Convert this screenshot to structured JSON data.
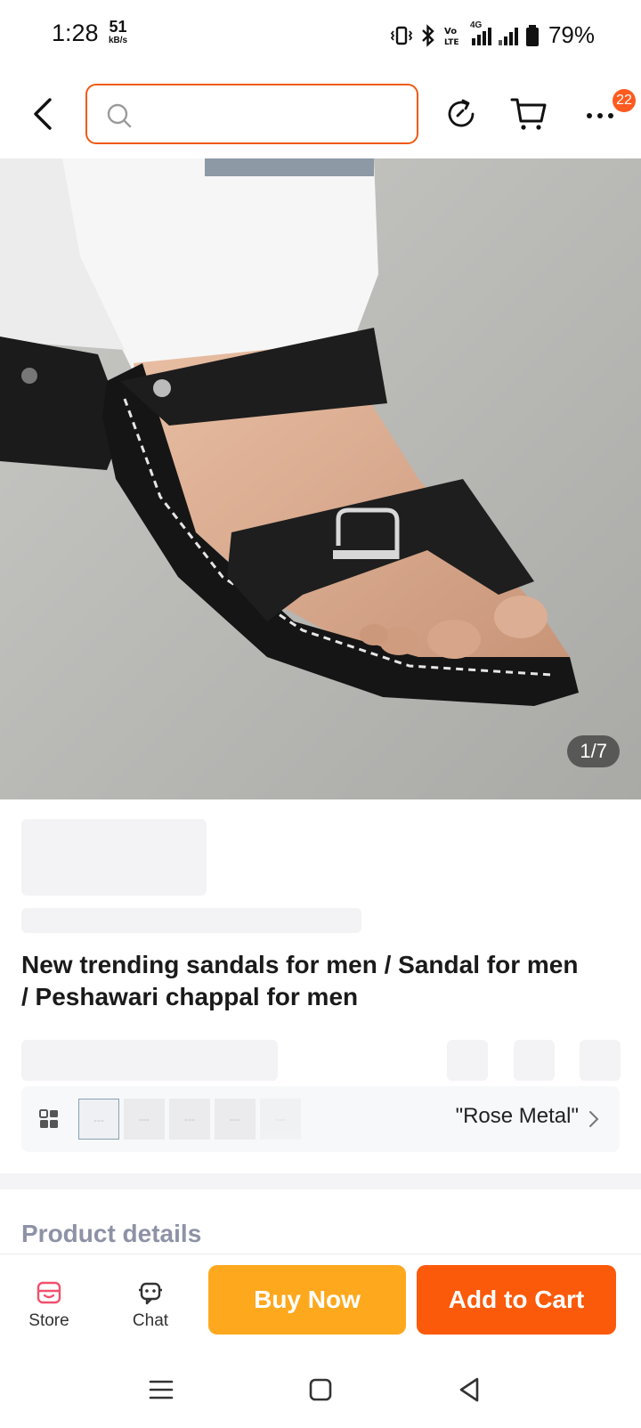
{
  "status_bar": {
    "time": "1:28",
    "speed_value": "51",
    "speed_unit": "kB/s",
    "network": "4G",
    "battery": "79%"
  },
  "header": {
    "search_placeholder": "",
    "cart_badge": "22"
  },
  "gallery": {
    "counter": "1/7"
  },
  "product": {
    "title": "New trending sandals for men / Sandal for men / Peshawari chappal for men"
  },
  "variants": {
    "selected_label": "\"Rose Metal\"",
    "thumbs": [
      "---",
      "---",
      "---",
      "---",
      "---"
    ]
  },
  "details": {
    "heading": "Product details"
  },
  "actions": {
    "store_label": "Store",
    "chat_label": "Chat",
    "buy_now_label": "Buy Now",
    "add_to_cart_label": "Add to Cart"
  },
  "colors": {
    "accent_orange": "#fb5a0a",
    "buy_yellow": "#fea81e",
    "search_border": "#f05a10",
    "store_icon": "#f0506e"
  }
}
